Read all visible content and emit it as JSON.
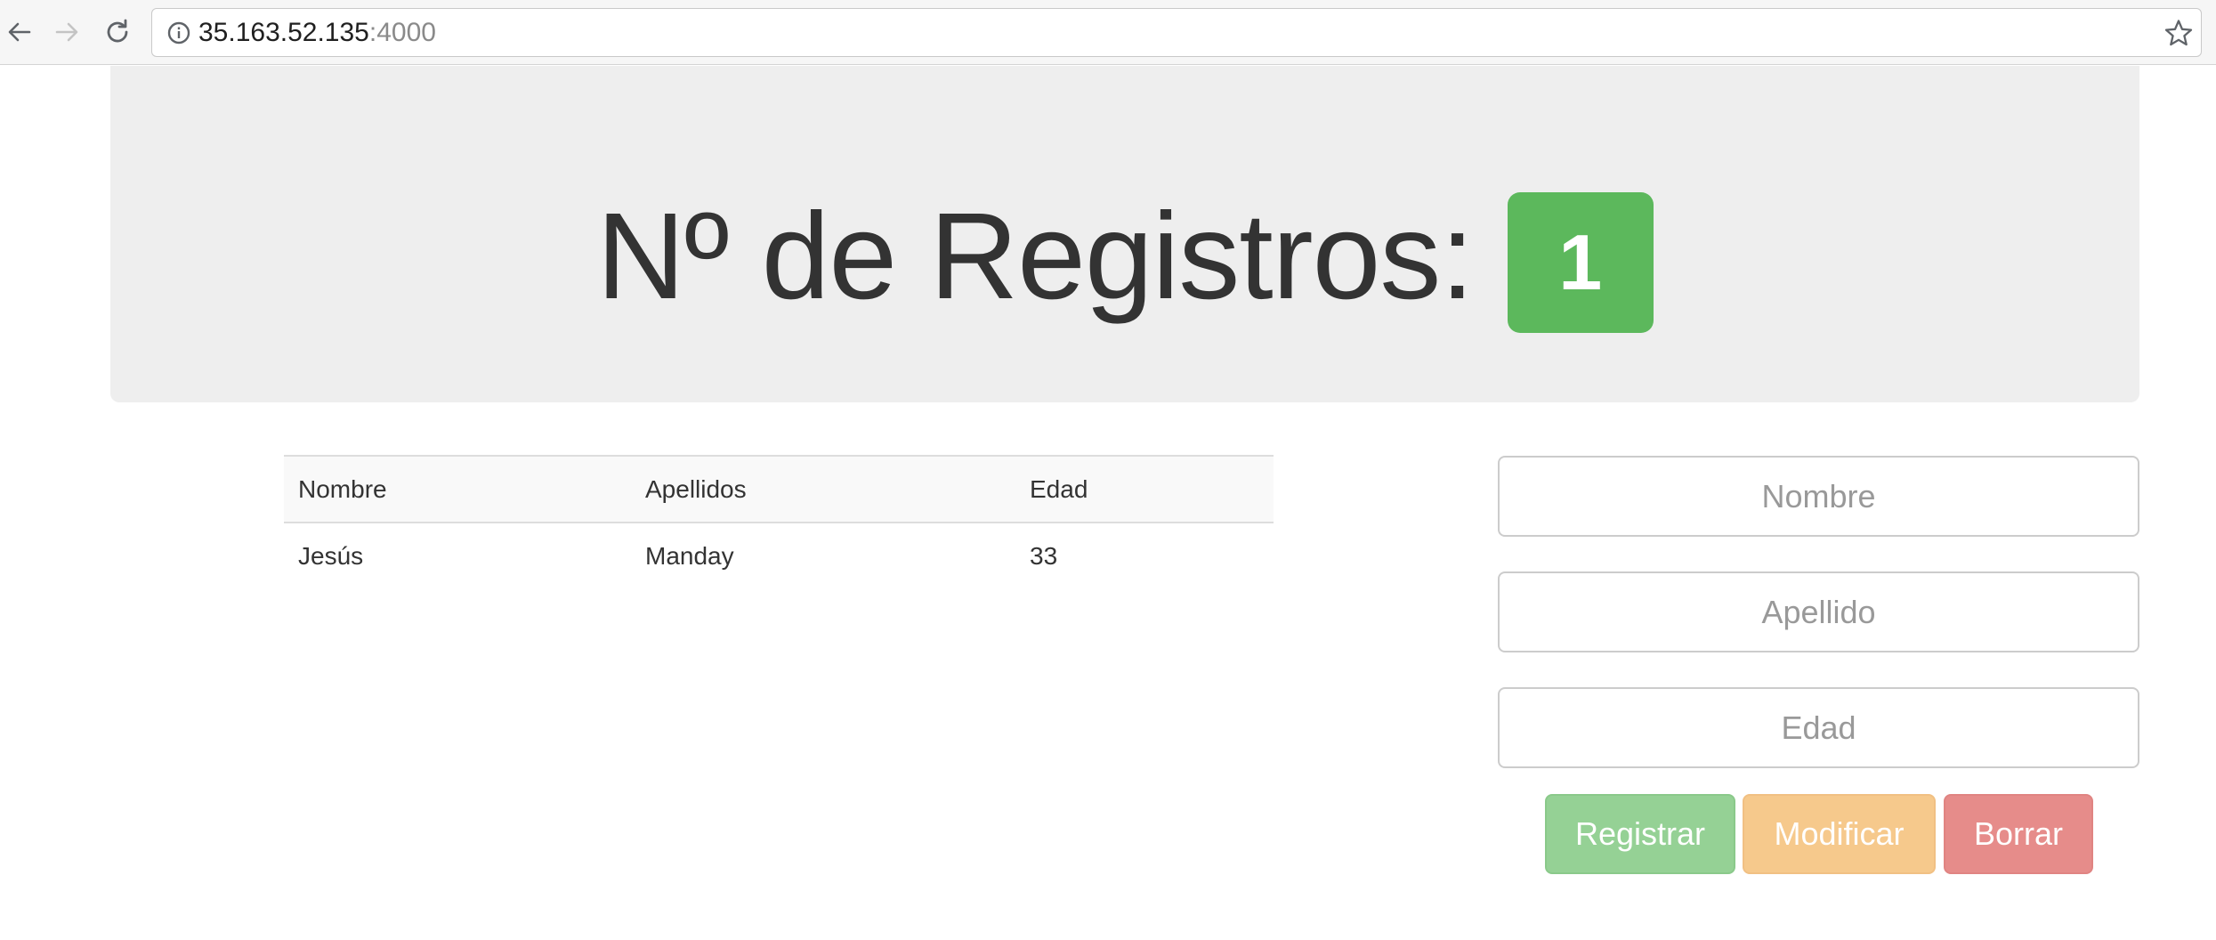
{
  "browser": {
    "url_host": "35.163.52.135",
    "url_port": ":4000",
    "icons": {
      "back": "arrow-left-icon",
      "forward": "arrow-right-icon",
      "reload": "reload-icon",
      "info": "info-icon",
      "bookmark": "star-icon"
    }
  },
  "header": {
    "title": "Nº de Registros:",
    "count": "1",
    "badge_color": "#5cb85c"
  },
  "table": {
    "columns": [
      "Nombre",
      "Apellidos",
      "Edad"
    ],
    "rows": [
      [
        "Jesús",
        "Manday",
        "33"
      ]
    ]
  },
  "form": {
    "nombre_placeholder": "Nombre",
    "apellido_placeholder": "Apellido",
    "edad_placeholder": "Edad",
    "registrar_label": "Registrar",
    "modificar_label": "Modificar",
    "borrar_label": "Borrar",
    "colors": {
      "registrar": "#95d195",
      "modificar": "#f6c98c",
      "borrar": "#e68c8a"
    }
  }
}
